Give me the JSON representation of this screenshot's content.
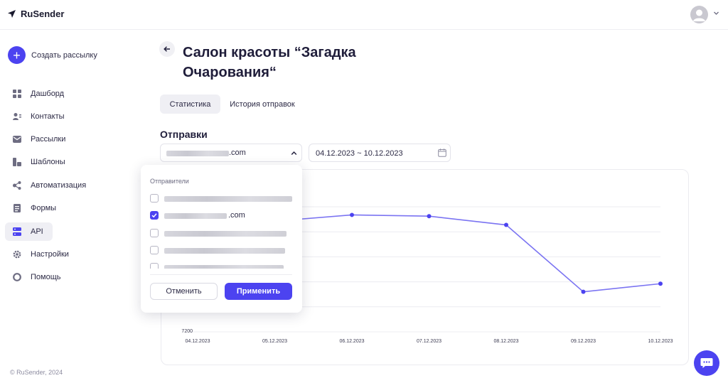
{
  "app": {
    "name": "RuSender",
    "footer": "© RuSender, 2024"
  },
  "sidebar": {
    "create_label": "Создать рассылку",
    "items": [
      {
        "label": "Дашборд",
        "icon": "dashboard-icon"
      },
      {
        "label": "Контакты",
        "icon": "contacts-icon"
      },
      {
        "label": "Рассылки",
        "icon": "mailings-icon"
      },
      {
        "label": "Шаблоны",
        "icon": "templates-icon"
      },
      {
        "label": "Автоматизация",
        "icon": "automation-icon"
      },
      {
        "label": "Формы",
        "icon": "forms-icon"
      },
      {
        "label": "API",
        "icon": "api-icon",
        "active": true
      },
      {
        "label": "Настройки",
        "icon": "settings-icon"
      },
      {
        "label": "Помощь",
        "icon": "help-icon"
      }
    ]
  },
  "page": {
    "title": "Салон красоты “Загадка Очарования“",
    "tabs": [
      {
        "label": "Статистика",
        "active": true
      },
      {
        "label": "История отправок",
        "active": false
      }
    ],
    "section_title": "Отправки",
    "sender_select": {
      "value_suffix": ".com"
    },
    "date_range": {
      "value": "04.12.2023 ~ 10.12.2023"
    }
  },
  "dropdown": {
    "title": "Отправители",
    "options": [
      {
        "suffix": "",
        "checked": false
      },
      {
        "suffix": ".com",
        "checked": true
      },
      {
        "suffix": "",
        "checked": false
      },
      {
        "suffix": "",
        "checked": false
      },
      {
        "suffix": "",
        "checked": false
      }
    ],
    "cancel_label": "Отменить",
    "apply_label": "Применить"
  },
  "colors": {
    "accent": "#4c43f0",
    "line": "#7b74f2"
  },
  "chart_data": {
    "type": "line",
    "categories": [
      "04.12.2023",
      "05.12.2023",
      "06.12.2023",
      "07.12.2023",
      "08.12.2023",
      "09.12.2023",
      "10.12.2023"
    ],
    "y_tick_labels": [
      "7200"
    ],
    "ylim": [
      7200,
      7400
    ],
    "grid": true,
    "series": [
      {
        "values": [
          null,
          null,
          7387,
          7385,
          7371,
          7264,
          7277
        ]
      }
    ]
  }
}
